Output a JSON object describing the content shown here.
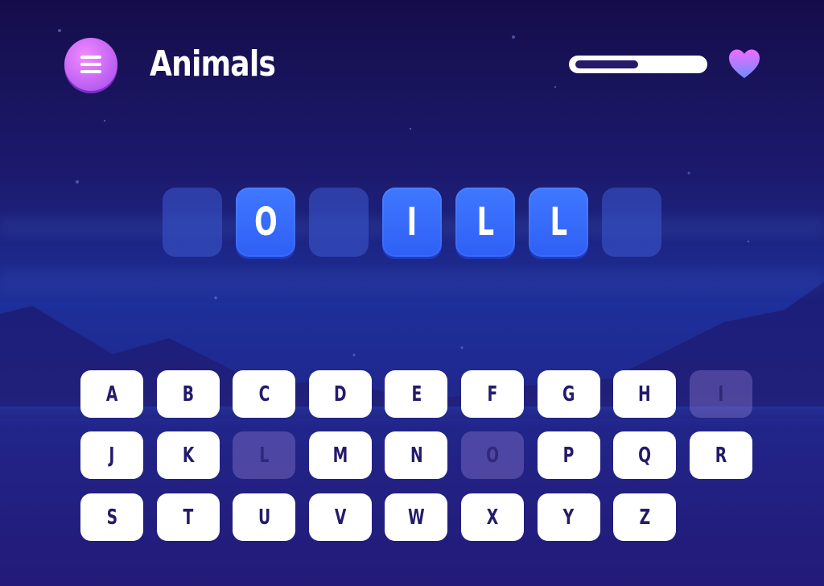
{
  "header": {
    "title": "Animals",
    "menu_icon": "hamburger-menu-icon",
    "heart_icon": "heart-icon",
    "progress_fraction": 0.5
  },
  "colors": {
    "background_top": "#150d4a",
    "background_mid": "#1d2f9a",
    "menu_button": "#c667f5",
    "tile_filled": "#3568fb",
    "tile_empty": "#3c5ad2",
    "key_bg": "#ffffff",
    "key_text": "#241b6b",
    "heart_top": "#f06bff",
    "heart_bottom": "#6f8dff"
  },
  "word_slots": [
    {
      "letter": "",
      "revealed": false
    },
    {
      "letter": "O",
      "revealed": true
    },
    {
      "letter": "",
      "revealed": false
    },
    {
      "letter": "I",
      "revealed": true
    },
    {
      "letter": "L",
      "revealed": true
    },
    {
      "letter": "L",
      "revealed": true
    },
    {
      "letter": "",
      "revealed": false
    }
  ],
  "keyboard": {
    "rows": [
      [
        "A",
        "B",
        "C",
        "D",
        "E",
        "F",
        "G",
        "H",
        "I"
      ],
      [
        "J",
        "K",
        "L",
        "M",
        "N",
        "O",
        "P",
        "Q",
        "R"
      ],
      [
        "S",
        "T",
        "U",
        "V",
        "W",
        "X",
        "Y",
        "Z"
      ]
    ],
    "used": [
      "I",
      "L",
      "O"
    ]
  }
}
